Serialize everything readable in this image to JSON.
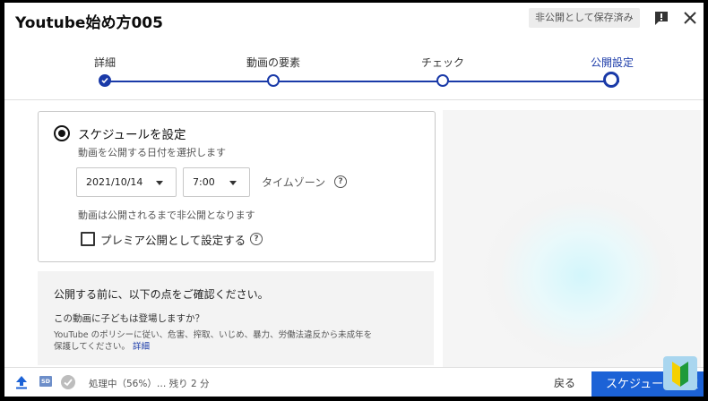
{
  "header": {
    "title": "Youtube始め方005",
    "saved_label": "非公開として保存済み"
  },
  "steps": [
    {
      "label": "詳細",
      "state": "done"
    },
    {
      "label": "動画の要素",
      "state": "pending"
    },
    {
      "label": "チェック",
      "state": "pending"
    },
    {
      "label": "公開設定",
      "state": "active"
    }
  ],
  "schedule": {
    "title": "スケジュールを設定",
    "subtitle": "動画を公開する日付を選択します",
    "date": "2021/10/14",
    "time": "7:00",
    "timezone_label": "タイムゾーン",
    "note": "動画は公開されるまで非公開となります",
    "premiere_label": "プレミア公開として設定する",
    "premiere_checked": false,
    "selected": true
  },
  "info": {
    "title": "公開する前に、以下の点をご確認ください。",
    "question": "この動画に子どもは登場しますか？",
    "policy": "YouTube のポリシーに従い、危害、搾取、いじめ、暴力、労働法違反から未成年を保護してください。",
    "link": "詳細"
  },
  "footer": {
    "status": "処理中（56%）… 残り 2 分",
    "progress_percent": 56,
    "back_label": "戻る",
    "primary_label": "スケジュール設定"
  },
  "colors": {
    "accent": "#1a3aa8",
    "primary_button": "#1c62d6"
  }
}
